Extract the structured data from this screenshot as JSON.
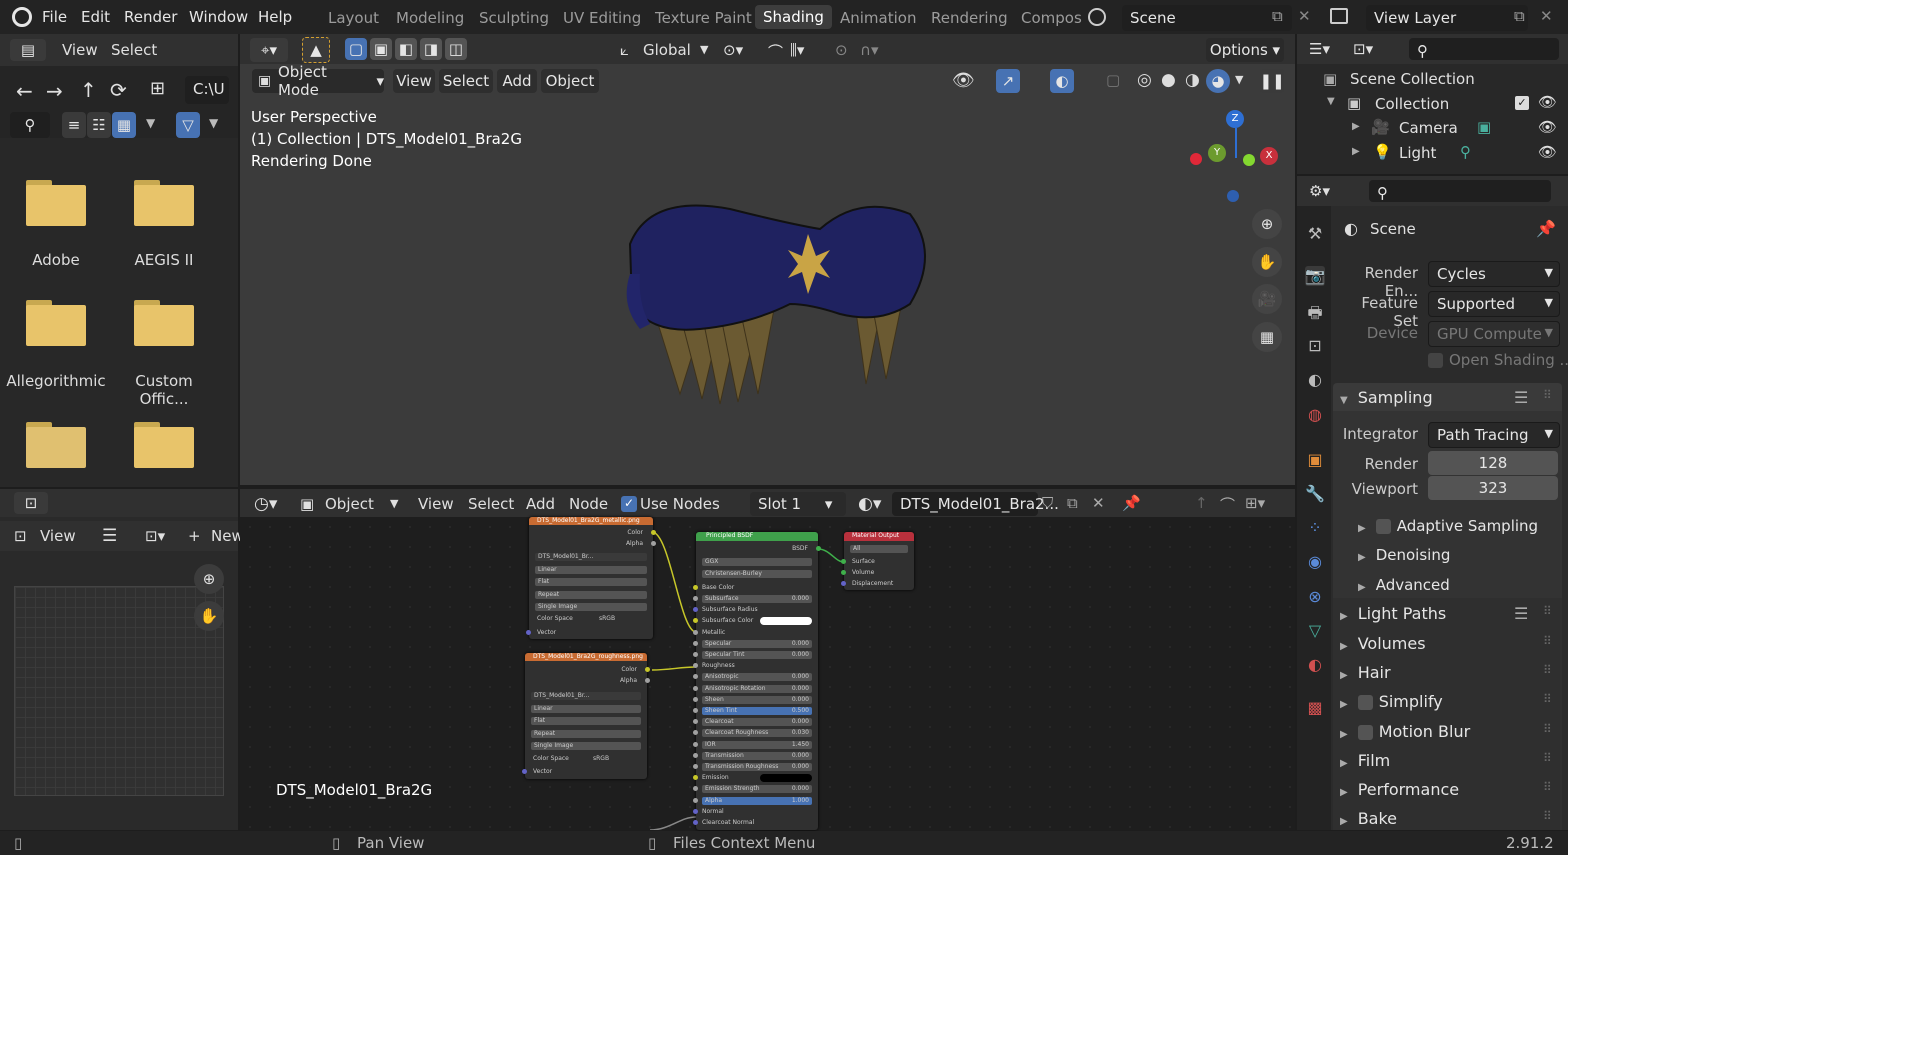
{
  "menu": {
    "items": [
      "File",
      "Edit",
      "Render",
      "Window",
      "Help"
    ]
  },
  "workspaces": {
    "tabs": [
      "Layout",
      "Modeling",
      "Sculpting",
      "UV Editing",
      "Texture Paint",
      "Shading",
      "Animation",
      "Rendering",
      "Compos"
    ],
    "active": "Shading"
  },
  "scene": {
    "name": "Scene",
    "view_layer": "View Layer"
  },
  "file_browser": {
    "header": {
      "view": "View",
      "select": "Select",
      "path": "C:\\U"
    },
    "folders": [
      "Adobe",
      "AEGIS II",
      "Allegorithmic",
      "Custom Offic..."
    ]
  },
  "image_editor": {
    "view": "View",
    "new_label": "New"
  },
  "viewport": {
    "mode": "Object Mode",
    "menus": [
      "View",
      "Select",
      "Add",
      "Object"
    ],
    "transform": "Global",
    "options": "Options",
    "overlay_lines": [
      "User Perspective",
      "(1) Collection | DTS_Model01_Bra2G",
      "Rendering Done"
    ],
    "gizmo_axes": {
      "z": "Z",
      "y": "Y",
      "x": "X"
    }
  },
  "node_editor": {
    "type": "Object",
    "menus": [
      "View",
      "Select",
      "Add",
      "Node"
    ],
    "use_nodes": "Use Nodes",
    "slot": "Slot 1",
    "material": "DTS_Model01_Bra2...",
    "object_label": "DTS_Model01_Bra2G",
    "img_node1": {
      "title": "DTS_Model01_Bra2G_metallic.png",
      "out1": "Color",
      "out2": "Alpha",
      "file": "DTS_Model01_Br...",
      "rows": [
        "Linear",
        "Flat",
        "Repeat",
        "Single Image"
      ],
      "cs_label": "Color Space",
      "cs_value": "sRGB",
      "vector": "Vector"
    },
    "img_node2": {
      "title": "DTS_Model01_Bra2G_roughness.png",
      "out1": "Color",
      "out2": "Alpha",
      "file": "DTS_Model01_Br...",
      "rows": [
        "Linear",
        "Flat",
        "Repeat",
        "Single Image"
      ],
      "cs_label": "Color Space",
      "cs_value": "sRGB",
      "vector": "Vector"
    },
    "bsdf": {
      "title": "Principled BSDF",
      "out": "BSDF",
      "dist": "GGX",
      "sss": "Christensen-Burley",
      "base_color": "Base Color",
      "rows": [
        {
          "l": "Subsurface",
          "v": "0.000"
        },
        {
          "l": "Subsurface Radius",
          "v": ""
        },
        {
          "l": "Subsurface Color",
          "v": ""
        },
        {
          "l": "Metallic",
          "v": ""
        },
        {
          "l": "Specular",
          "v": "0.000"
        },
        {
          "l": "Specular Tint",
          "v": "0.000"
        },
        {
          "l": "Roughness",
          "v": ""
        },
        {
          "l": "Anisotropic",
          "v": "0.000"
        },
        {
          "l": "Anisotropic Rotation",
          "v": "0.000"
        },
        {
          "l": "Sheen",
          "v": "0.000"
        },
        {
          "l": "Sheen Tint",
          "v": "0.500"
        },
        {
          "l": "Clearcoat",
          "v": "0.000"
        },
        {
          "l": "Clearcoat Roughness",
          "v": "0.030"
        },
        {
          "l": "IOR",
          "v": "1.450"
        },
        {
          "l": "Transmission",
          "v": "0.000"
        },
        {
          "l": "Transmission Roughness",
          "v": "0.000"
        },
        {
          "l": "Emission",
          "v": ""
        },
        {
          "l": "Emission Strength",
          "v": "0.000"
        },
        {
          "l": "Alpha",
          "v": "1.000"
        },
        {
          "l": "Normal",
          "v": ""
        },
        {
          "l": "Clearcoat Normal",
          "v": ""
        }
      ]
    },
    "output": {
      "title": "Material Output",
      "target": "All",
      "inputs": [
        "Surface",
        "Volume",
        "Displacement"
      ]
    }
  },
  "outliner": {
    "root": "Scene Collection",
    "collection": "Collection",
    "items": [
      "Camera",
      "Light"
    ]
  },
  "properties": {
    "context": "Scene",
    "render_engine": {
      "label": "Render En...",
      "value": "Cycles"
    },
    "feature_set": {
      "label": "Feature Set",
      "value": "Supported"
    },
    "device": {
      "label": "Device",
      "value": "GPU Compute"
    },
    "open_shading": "Open Shading ...",
    "sampling": "Sampling",
    "integrator": {
      "label": "Integrator",
      "value": "Path Tracing"
    },
    "render": {
      "label": "Render",
      "value": "128"
    },
    "viewport": {
      "label": "Viewport",
      "value": "323"
    },
    "subpanels": [
      "Adaptive Sampling",
      "Denoising",
      "Advanced"
    ],
    "panels": [
      "Light Paths",
      "Volumes",
      "Hair",
      "Simplify",
      "Motion Blur",
      "Film",
      "Performance",
      "Bake"
    ]
  },
  "status_bar": {
    "pan": "Pan View",
    "context": "Files Context Menu",
    "version": "2.91.2"
  },
  "colors": {
    "accent": "#4772b3",
    "active_ws": "#3d3d3d",
    "header": "#303030",
    "folder": "#e8c46a"
  }
}
